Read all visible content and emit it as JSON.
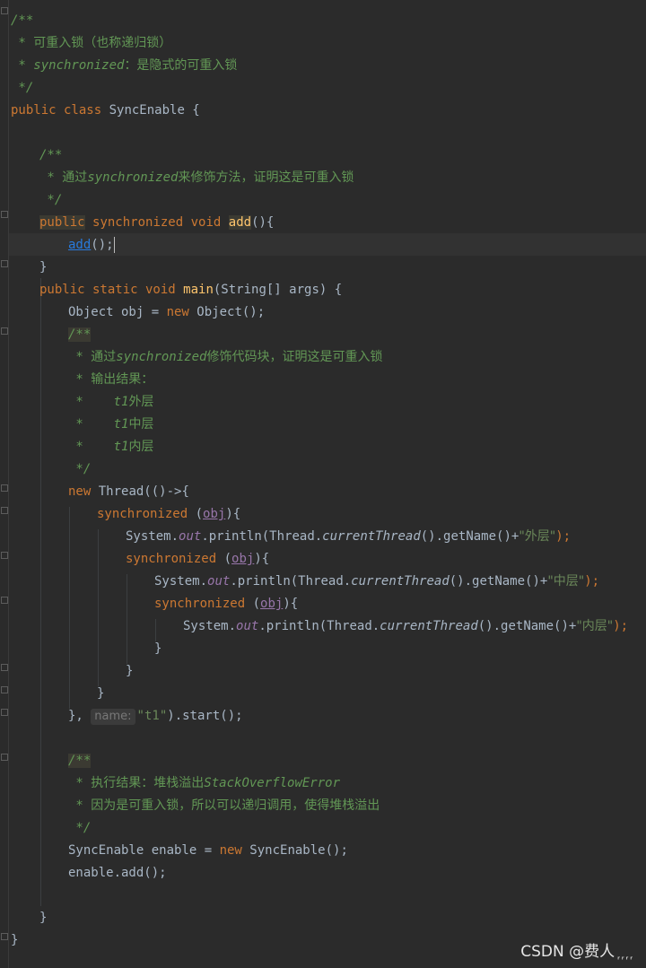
{
  "editor": {
    "lines": {
      "l1": "/**",
      "l2_a": " * ",
      "l2_b": "可重入锁（也称递归锁）",
      "l3_a": " * synchronized",
      "l3_b": "：是隐式的可重入锁",
      "l4": " */",
      "l5_kw": "public class",
      "l5_rest": " SyncEnable {",
      "l7": "/**",
      "l8_a": " * ",
      "l8_b": "通过",
      "l8_c": "synchronized",
      "l8_d": "来修饰方法，证明这是可重入锁",
      "l9": " */",
      "l10_pub": "public",
      "l10_sync": "synchronized",
      "l10_void": "void",
      "l10_add": "add",
      "l10_rest": "(){",
      "l11_add": "add",
      "l11_rest": "();",
      "l12": "}",
      "l13_kw": "public static void",
      "l13_main": "main",
      "l13_rest": "(String[] args) {",
      "l14_a": "Object obj = ",
      "l14_new": "new",
      "l14_b": " Object();",
      "l15": "/**",
      "l16_a": " * ",
      "l16_b": "通过",
      "l16_c": "synchronized",
      "l16_d": "修饰代码块，证明这是可重入锁",
      "l17_a": " * ",
      "l17_b": "输出结果：",
      "l18_a": " *    t1",
      "l18_b": "外层",
      "l19_a": " *    t1",
      "l19_b": "中层",
      "l20_a": " *    t1",
      "l20_b": "内层",
      "l21": " */",
      "l22_new": "new",
      "l22_rest": " Thread(()->{",
      "l23_sync": "synchronized",
      "l23_obj": "obj",
      "l24_sys": "System.",
      "l24_out": "out",
      "l24_print": ".println(Thread.",
      "l24_ct": "currentThread",
      "l24_mid": "().getName()+",
      "l24_str": "\"外层\"",
      "l24_end": ");",
      "l25_sync": "synchronized",
      "l25_obj": "obj",
      "l26_str": "\"中层\"",
      "l27_sync": "synchronized",
      "l27_obj": "obj",
      "l28_str": "\"内层\"",
      "l29": "}",
      "l30": "}",
      "l31": "}",
      "l32_a": "}, ",
      "l32_hint": "name:",
      "l32_str": "\"t1\"",
      "l32_b": ").start();",
      "l34": "/**",
      "l35_a": " * ",
      "l35_b": "执行结果：堆栈溢出",
      "l35_c": "StackOverflowError",
      "l36_a": " * ",
      "l36_b": "因为是可重入锁，所以可以递归调用，使得堆栈溢出",
      "l37": " */",
      "l38_a": "SyncEnable enable = ",
      "l38_new": "new",
      "l38_b": " SyncEnable();",
      "l39": "enable.add();",
      "l41": "}",
      "l42": "}"
    }
  },
  "watermark": "CSDN @费人 ᷊ ᷊ ᷊ ᷊",
  "colors": {
    "background": "#2b2b2b",
    "keyword": "#cc7832",
    "comment": "#629755",
    "method": "#ffc66d",
    "string": "#6a8759",
    "field": "#9876aa",
    "text": "#a9b7c6"
  }
}
